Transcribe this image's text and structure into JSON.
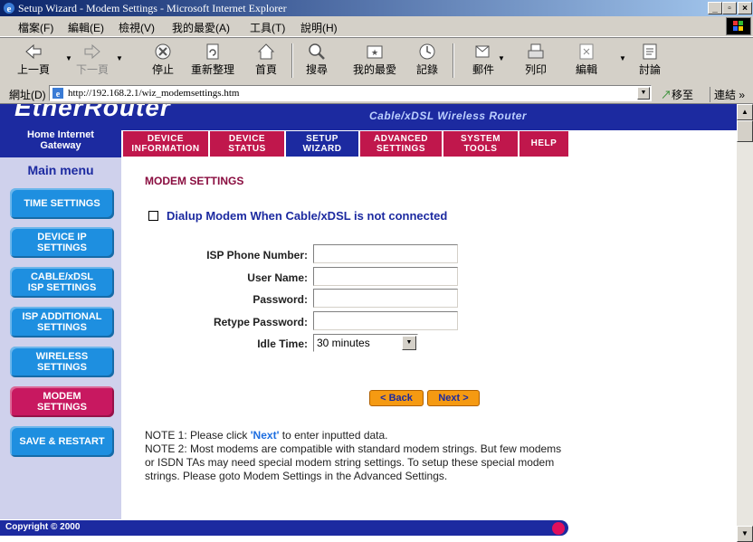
{
  "window": {
    "title": "Setup Wizard - Modem Settings - Microsoft Internet Explorer"
  },
  "menubar": [
    "檔案(F)",
    "編輯(E)",
    "檢視(V)",
    "我的最愛(A)",
    "工具(T)",
    "說明(H)"
  ],
  "toolbar": {
    "back": "上一頁",
    "forward": "下一頁",
    "stop": "停止",
    "refresh": "重新整理",
    "home": "首頁",
    "search": "搜尋",
    "favorites": "我的最愛",
    "history": "記錄",
    "mail": "郵件",
    "print": "列印",
    "edit": "編輯",
    "discuss": "討論"
  },
  "address": {
    "label": "網址(D)",
    "url": "http://192.168.2.1/wiz_modemsettings.htm",
    "go": "移至",
    "links": "連結"
  },
  "header": {
    "brand": "EtherRouter",
    "tagline": "Cable/xDSL Wireless Router",
    "home_gateway": "Home Internet\nGateway",
    "tabs": [
      "DEVICE\nINFORMATION",
      "DEVICE\nSTATUS",
      "SETUP\nWIZARD",
      "ADVANCED\nSETTINGS",
      "SYSTEM\nTOOLS",
      "HELP"
    ]
  },
  "sidebar": {
    "title": "Main menu",
    "items": [
      "TIME SETTINGS",
      "DEVICE IP\nSETTINGS",
      "CABLE/xDSL\nISP SETTINGS",
      "ISP ADDITIONAL\nSETTINGS",
      "WIRELESS\nSETTINGS",
      "MODEM\nSETTINGS",
      "SAVE & RESTART"
    ]
  },
  "main": {
    "page_title": "MODEM SETTINGS",
    "dialup_label": "Dialup Modem When Cable/xDSL is not connected",
    "fields": {
      "isp_phone": {
        "label": "ISP Phone Number:",
        "value": ""
      },
      "user_name": {
        "label": "User Name:",
        "value": ""
      },
      "password": {
        "label": "Password:",
        "value": ""
      },
      "retype_password": {
        "label": "Retype Password:",
        "value": ""
      },
      "idle_time": {
        "label": "Idle Time:",
        "value": "30 minutes"
      }
    },
    "back_label": "< Back",
    "next_label": "Next >",
    "note1_prefix": "NOTE 1: Please click ",
    "note1_link": "'Next'",
    "note1_suffix": " to enter inputted data.",
    "note2": "NOTE 2: Most modems are compatible with standard modem strings. But few modems or ISDN TAs may need special modem string settings. To setup these special modem strings. Please goto Modem Settings in the Advanced Settings."
  },
  "footer": {
    "copyright": "Copyright © 2000"
  },
  "colors": {
    "header_blue": "#1c2aa0",
    "tab_red": "#c0174c",
    "nav_blue": "#1e8fe0",
    "nav_active": "#c81860",
    "button_orange": "#f59a12",
    "title_maroon": "#8a0e40"
  }
}
